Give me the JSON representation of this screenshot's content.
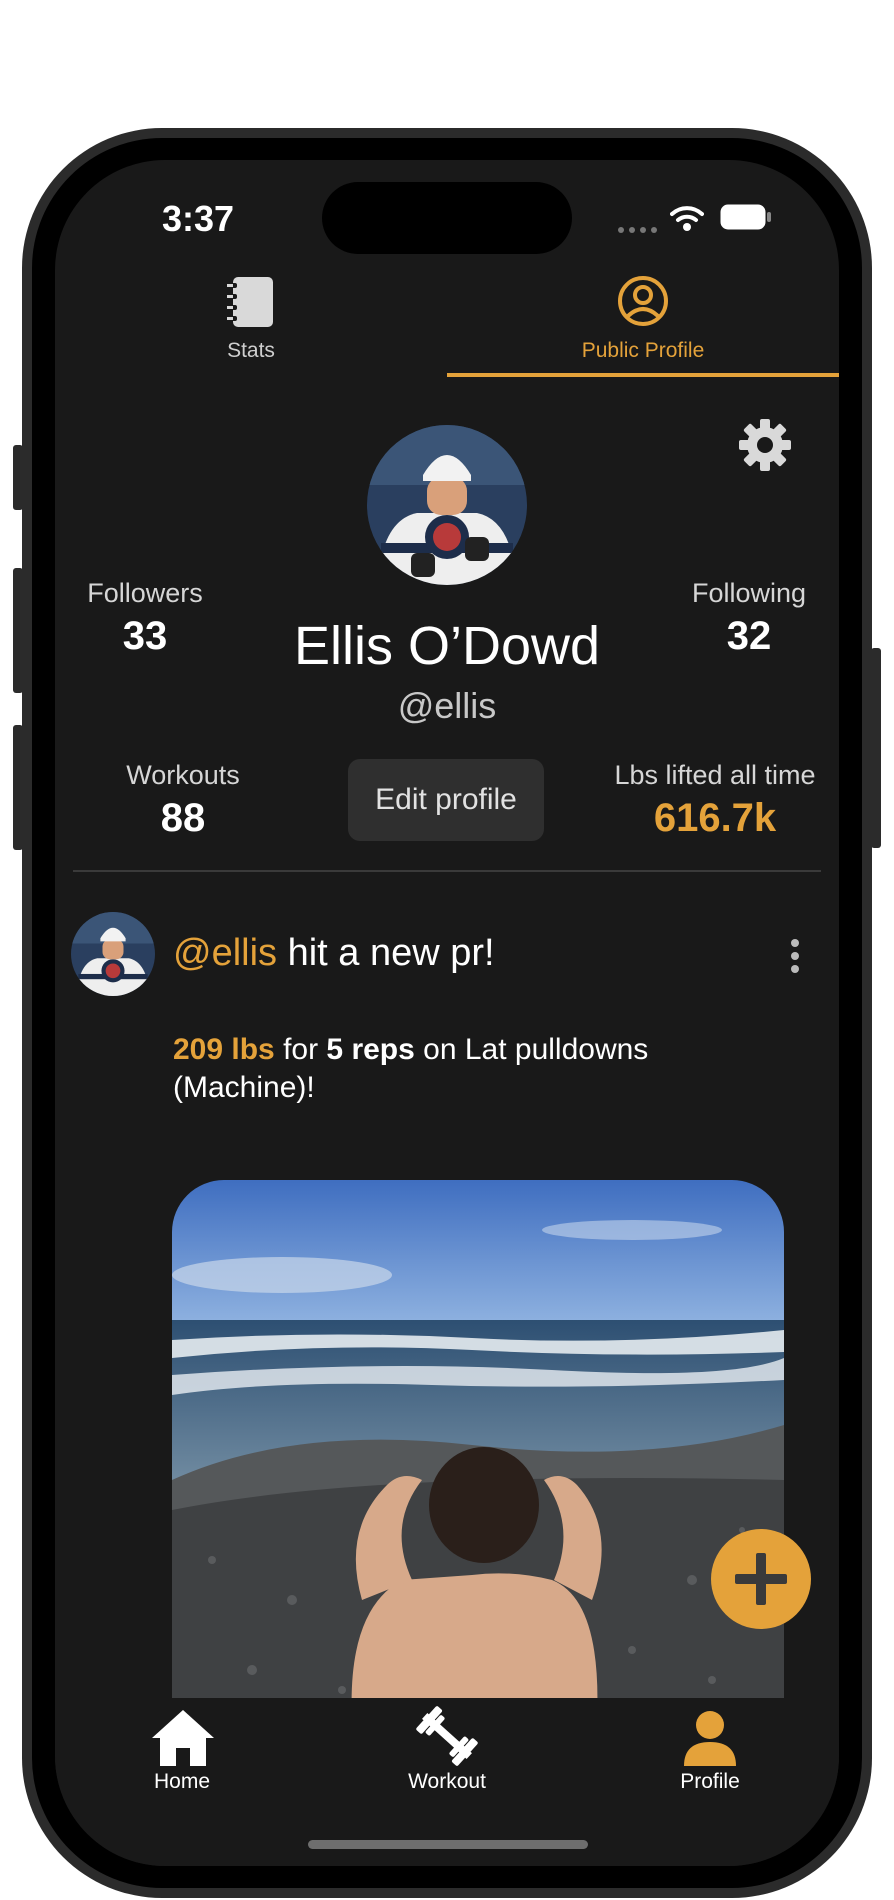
{
  "status_bar": {
    "time": "3:37"
  },
  "top_tabs": [
    {
      "label": "Stats",
      "icon": "notebook-icon",
      "active": false
    },
    {
      "label": "Public Profile",
      "icon": "user-circle-icon",
      "active": true
    }
  ],
  "profile": {
    "name": "Ellis O’Dowd",
    "handle": "@ellis",
    "followers_label": "Followers",
    "followers_value": "33",
    "following_label": "Following",
    "following_value": "32",
    "workouts_label": "Workouts",
    "workouts_value": "88",
    "lbs_label": "Lbs lifted all time",
    "lbs_value": "616.7k",
    "edit_label": "Edit profile"
  },
  "feed": {
    "post": {
      "author_handle": "@ellis",
      "headline_rest": " hit a new pr!",
      "weight": "209 lbs",
      "for_text": " for ",
      "reps": "5 reps",
      "exercise_line1": " on Lat pulldowns",
      "exercise_line2": "(Machine)!"
    }
  },
  "bottom_nav": [
    {
      "label": "Home",
      "icon": "home-icon",
      "active": false
    },
    {
      "label": "Workout",
      "icon": "dumbbell-icon",
      "active": false
    },
    {
      "label": "Profile",
      "icon": "person-icon",
      "active": true
    }
  ],
  "colors": {
    "accent": "#e4a23a",
    "background": "#191919",
    "button": "#2f2f2f"
  }
}
